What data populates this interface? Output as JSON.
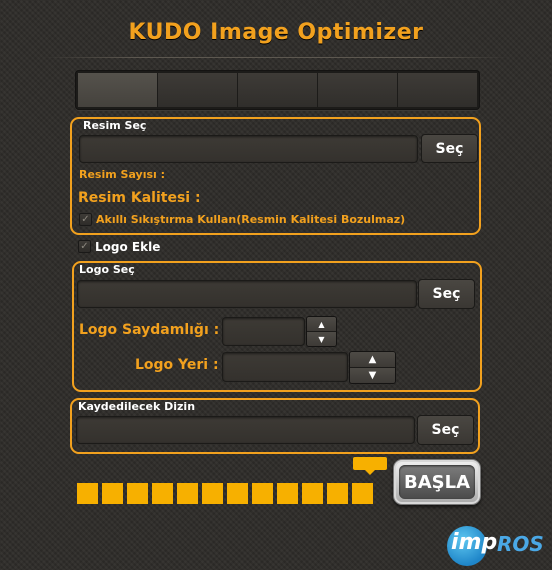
{
  "app": {
    "title": "KUDO Image Optimizer"
  },
  "tabs": [
    "",
    "",
    "",
    "",
    ""
  ],
  "image_group": {
    "label": "Resim Seç",
    "path_value": "",
    "select_button": "Seç",
    "count_label": "Resim Sayısı :",
    "quality_label": "Resim Kalitesi :",
    "smart_compress_label": "Akıllı Sıkıştırma Kullan(Resmin Kalitesi Bozulmaz)",
    "smart_compress_checked": true
  },
  "logo_toggle": {
    "label": "Logo Ekle",
    "checked": true
  },
  "logo_group": {
    "label": "Logo Seç",
    "path_value": "",
    "select_button": "Seç",
    "opacity_label": "Logo Saydamlığı :",
    "opacity_value": "",
    "position_label": "Logo Yeri :",
    "position_value": ""
  },
  "output_group": {
    "label": "Kaydedilecek Dizin",
    "path_value": "",
    "select_button": "Seç"
  },
  "progress": {
    "segments": 12,
    "filled": 12
  },
  "start_button": "BAŞLA",
  "brand": {
    "imp": "imp",
    "ros": "ROS"
  },
  "colors": {
    "accent": "#f2a11e",
    "progress": "#f7b000",
    "brand_blue": "#1f86c9"
  },
  "icons": {
    "spin_up": "▲",
    "spin_down": "▼",
    "check": "✓"
  }
}
